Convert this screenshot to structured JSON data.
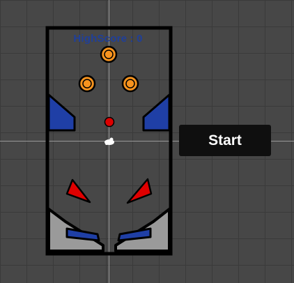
{
  "game": {
    "highscore_label": "HighScore : 0",
    "start_label": "Start"
  },
  "colors": {
    "board_outline": "#000000",
    "bumper_orange": "#f7931e",
    "guide_blue": "#1f3fa6",
    "kicker_red": "#e00000",
    "ball_red": "#dd0000",
    "wall_gray": "#9a9a9a",
    "button_bg": "#0f0f0f"
  },
  "icons": [
    "pinball-ball",
    "bumper",
    "flipper",
    "slingshot",
    "player-marker"
  ]
}
